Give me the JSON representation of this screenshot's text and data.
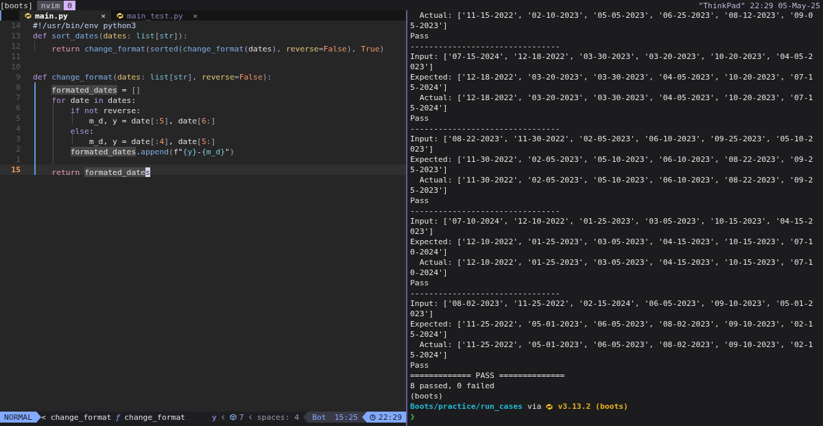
{
  "tmux": {
    "session": "[boots]",
    "windows": [
      {
        "name": "nvim",
        "index": "0",
        "selected": true
      }
    ],
    "status_right": "\"ThinkPad\" 22:29 05-May-25"
  },
  "editor": {
    "tabs": [
      {
        "label": "main.py",
        "selected": true,
        "close": "×"
      },
      {
        "label": "main_test.py",
        "selected": false,
        "close": "×"
      }
    ],
    "lines": [
      {
        "number": "14",
        "current": false,
        "tokens": [
          {
            "text": "#!/usr/bin/env python3",
            "kind": "comment"
          }
        ]
      },
      {
        "number": "13",
        "current": false,
        "tokens": [
          {
            "text": "def ",
            "kind": "kw"
          },
          {
            "text": "sort_dates",
            "kind": "fn"
          },
          {
            "text": "(",
            "kind": "punct"
          },
          {
            "text": "dates",
            "kind": "param"
          },
          {
            "text": ": ",
            "kind": "punct"
          },
          {
            "text": "list",
            "kind": "type"
          },
          {
            "text": "[",
            "kind": "punct"
          },
          {
            "text": "str",
            "kind": "type"
          },
          {
            "text": "]):",
            "kind": "punct"
          }
        ]
      },
      {
        "number": "12",
        "current": false,
        "tokens": [
          {
            "kind": "guide"
          },
          {
            "text": "return ",
            "kind": "ret"
          },
          {
            "text": "change_format",
            "kind": "fn"
          },
          {
            "text": "(",
            "kind": "punct"
          },
          {
            "text": "sorted",
            "kind": "fn"
          },
          {
            "text": "(",
            "kind": "punct"
          },
          {
            "text": "change_format",
            "kind": "fn"
          },
          {
            "text": "(",
            "kind": "punct"
          },
          {
            "text": "dates",
            "kind": "plain"
          },
          {
            "text": "), ",
            "kind": "punct"
          },
          {
            "text": "reverse",
            "kind": "param"
          },
          {
            "text": "=",
            "kind": "punct"
          },
          {
            "text": "False",
            "kind": "bool"
          },
          {
            "text": "), ",
            "kind": "punct"
          },
          {
            "text": "True",
            "kind": "bool"
          },
          {
            "text": ")",
            "kind": "punct"
          }
        ]
      },
      {
        "number": "11",
        "current": false
      },
      {
        "number": "10",
        "current": false
      },
      {
        "number": "9",
        "current": false,
        "tokens": [
          {
            "text": "def ",
            "kind": "kw"
          },
          {
            "text": "change_format",
            "kind": "fn"
          },
          {
            "text": "(",
            "kind": "punct"
          },
          {
            "text": "dates",
            "kind": "param"
          },
          {
            "text": ": ",
            "kind": "punct"
          },
          {
            "text": "list",
            "kind": "type"
          },
          {
            "text": "[",
            "kind": "punct"
          },
          {
            "text": "str",
            "kind": "type"
          },
          {
            "text": "], ",
            "kind": "punct"
          },
          {
            "text": "reverse",
            "kind": "param"
          },
          {
            "text": "=",
            "kind": "punct"
          },
          {
            "text": "False",
            "kind": "bool"
          },
          {
            "text": "):",
            "kind": "punct"
          }
        ]
      },
      {
        "number": "8",
        "current": false,
        "tokens": [
          {
            "kind": "guide_active"
          },
          {
            "text": "formated_dates",
            "kind": "ref"
          },
          {
            "text": " = ",
            "kind": "plain"
          },
          {
            "text": "[]",
            "kind": "punct"
          }
        ]
      },
      {
        "number": "7",
        "current": false,
        "tokens": [
          {
            "kind": "guide_active"
          },
          {
            "text": "for",
            "kind": "kw"
          },
          {
            "text": " date ",
            "kind": "plain"
          },
          {
            "text": "in",
            "kind": "kw"
          },
          {
            "text": " dates:",
            "kind": "plain"
          }
        ]
      },
      {
        "number": "6",
        "current": false,
        "tokens": [
          {
            "kind": "guide_active"
          },
          {
            "kind": "guide"
          },
          {
            "text": "if not",
            "kind": "kw"
          },
          {
            "text": " reverse:",
            "kind": "plain"
          }
        ]
      },
      {
        "number": "5",
        "current": false,
        "tokens": [
          {
            "kind": "guide_active"
          },
          {
            "kind": "guide"
          },
          {
            "kind": "guide"
          },
          {
            "text": "m_d, y = date",
            "kind": "plain"
          },
          {
            "text": "[:",
            "kind": "punct"
          },
          {
            "text": "5",
            "kind": "num"
          },
          {
            "text": "]",
            "kind": "punct"
          },
          {
            "text": ", date",
            "kind": "plain"
          },
          {
            "text": "[",
            "kind": "punct"
          },
          {
            "text": "6",
            "kind": "num"
          },
          {
            "text": ":]",
            "kind": "punct"
          }
        ]
      },
      {
        "number": "4",
        "current": false,
        "tokens": [
          {
            "kind": "guide_active"
          },
          {
            "kind": "guide"
          },
          {
            "text": "else",
            "kind": "kw"
          },
          {
            "text": ":",
            "kind": "plain"
          }
        ]
      },
      {
        "number": "3",
        "current": false,
        "tokens": [
          {
            "kind": "guide_active"
          },
          {
            "kind": "guide"
          },
          {
            "kind": "guide"
          },
          {
            "text": "m_d, y = date",
            "kind": "plain"
          },
          {
            "text": "[:",
            "kind": "punct"
          },
          {
            "text": "4",
            "kind": "num"
          },
          {
            "text": "]",
            "kind": "punct"
          },
          {
            "text": ", date",
            "kind": "plain"
          },
          {
            "text": "[",
            "kind": "punct"
          },
          {
            "text": "5",
            "kind": "num"
          },
          {
            "text": ":]",
            "kind": "punct"
          }
        ]
      },
      {
        "number": "2",
        "current": false,
        "tokens": [
          {
            "kind": "guide_active"
          },
          {
            "kind": "guide"
          },
          {
            "text": "formated_dates",
            "kind": "ref"
          },
          {
            "text": ".",
            "kind": "plain"
          },
          {
            "text": "append",
            "kind": "fn"
          },
          {
            "text": "(",
            "kind": "punct"
          },
          {
            "text": "f\"",
            "kind": "plain"
          },
          {
            "text": "{y}",
            "kind": "interp"
          },
          {
            "text": "-",
            "kind": "plain"
          },
          {
            "text": "{m_d}",
            "kind": "interp"
          },
          {
            "text": "\"",
            "kind": "plain"
          },
          {
            "text": ")",
            "kind": "punct"
          }
        ]
      },
      {
        "number": "1",
        "current": false,
        "tokens": [
          {
            "kind": "guide_active"
          },
          {
            "kind": "guide"
          }
        ]
      },
      {
        "number": "15",
        "current": true,
        "tokens": [
          {
            "kind": "guide_active"
          },
          {
            "text": "return ",
            "kind": "ret"
          },
          {
            "text": "formated_date",
            "kind": "ref"
          },
          {
            "text": "s",
            "kind": "cursor"
          }
        ]
      }
    ],
    "statusline": {
      "mode": "NORMAL",
      "left": [
        {
          "text": "< change_format",
          "kind": "crumb"
        },
        {
          "text": "ƒ",
          "kind": "fn"
        },
        {
          "text": "change_format",
          "kind": "crumb"
        }
      ],
      "right": [
        {
          "text": "y",
          "kind": "register"
        },
        {
          "text": "‹",
          "kind": "sep"
        },
        {
          "text": "7",
          "kind": "diag"
        },
        {
          "text": "‹",
          "kind": "sep"
        },
        {
          "text": "spaces: 4",
          "kind": "muted"
        }
      ],
      "position": "Bot",
      "cursor": "15:25",
      "clock": "22:29"
    }
  },
  "terminal": {
    "lines": [
      {
        "kind": "output",
        "text": "  Actual: ['11-15-2022', '02-10-2023', '05-05-2023', '06-25-2023', '08-12-2023', '09-0"
      },
      {
        "kind": "output",
        "text": "5-2023']"
      },
      {
        "kind": "output",
        "text": "Pass"
      },
      {
        "kind": "output",
        "text": "--------------------------------"
      },
      {
        "kind": "output",
        "text": "Input: ['07-15-2024', '12-18-2022', '03-30-2023', '03-20-2023', '10-20-2023', '04-05-2"
      },
      {
        "kind": "output",
        "text": "023']"
      },
      {
        "kind": "output",
        "text": "Expected: ['12-18-2022', '03-20-2023', '03-30-2023', '04-05-2023', '10-20-2023', '07-1"
      },
      {
        "kind": "output",
        "text": "5-2024']"
      },
      {
        "kind": "output",
        "text": "  Actual: ['12-18-2022', '03-20-2023', '03-30-2023', '04-05-2023', '10-20-2023', '07-1"
      },
      {
        "kind": "output",
        "text": "5-2024']"
      },
      {
        "kind": "output",
        "text": "Pass"
      },
      {
        "kind": "output",
        "text": "--------------------------------"
      },
      {
        "kind": "output",
        "text": "Input: ['08-22-2023', '11-30-2022', '02-05-2023', '06-10-2023', '09-25-2023', '05-10-2"
      },
      {
        "kind": "output",
        "text": "023']"
      },
      {
        "kind": "output",
        "text": "Expected: ['11-30-2022', '02-05-2023', '05-10-2023', '06-10-2023', '08-22-2023', '09-2"
      },
      {
        "kind": "output",
        "text": "5-2023']"
      },
      {
        "kind": "output",
        "text": "  Actual: ['11-30-2022', '02-05-2023', '05-10-2023', '06-10-2023', '08-22-2023', '09-2"
      },
      {
        "kind": "output",
        "text": "5-2023']"
      },
      {
        "kind": "output",
        "text": "Pass"
      },
      {
        "kind": "output",
        "text": "--------------------------------"
      },
      {
        "kind": "output",
        "text": "Input: ['07-10-2024', '12-10-2022', '01-25-2023', '03-05-2023', '10-15-2023', '04-15-2"
      },
      {
        "kind": "output",
        "text": "023']"
      },
      {
        "kind": "output",
        "text": "Expected: ['12-10-2022', '01-25-2023', '03-05-2023', '04-15-2023', '10-15-2023', '07-1"
      },
      {
        "kind": "output",
        "text": "0-2024']"
      },
      {
        "kind": "output",
        "text": "  Actual: ['12-10-2022', '01-25-2023', '03-05-2023', '04-15-2023', '10-15-2023', '07-1"
      },
      {
        "kind": "output",
        "text": "0-2024']"
      },
      {
        "kind": "output",
        "text": "Pass"
      },
      {
        "kind": "output",
        "text": "--------------------------------"
      },
      {
        "kind": "output",
        "text": "Input: ['08-02-2023', '11-25-2022', '02-15-2024', '06-05-2023', '09-10-2023', '05-01-2"
      },
      {
        "kind": "output",
        "text": "023']"
      },
      {
        "kind": "output",
        "text": "Expected: ['11-25-2022', '05-01-2023', '06-05-2023', '08-02-2023', '09-10-2023', '02-1"
      },
      {
        "kind": "output",
        "text": "5-2024']"
      },
      {
        "kind": "output",
        "text": "  Actual: ['11-25-2022', '05-01-2023', '06-05-2023', '08-02-2023', '09-10-2023', '02-1"
      },
      {
        "kind": "output",
        "text": "5-2024']"
      },
      {
        "kind": "output",
        "text": "Pass"
      },
      {
        "kind": "output",
        "text": "============= PASS =============="
      },
      {
        "kind": "output",
        "text": "8 passed, 0 failed"
      },
      {
        "kind": "output",
        "text": "(boots)"
      },
      {
        "kind": "prompt",
        "path": "Boots/practice/run_cases",
        "via": "via",
        "version": "v3.13.2 (boots)"
      },
      {
        "kind": "input",
        "symbol": "❯"
      }
    ]
  }
}
